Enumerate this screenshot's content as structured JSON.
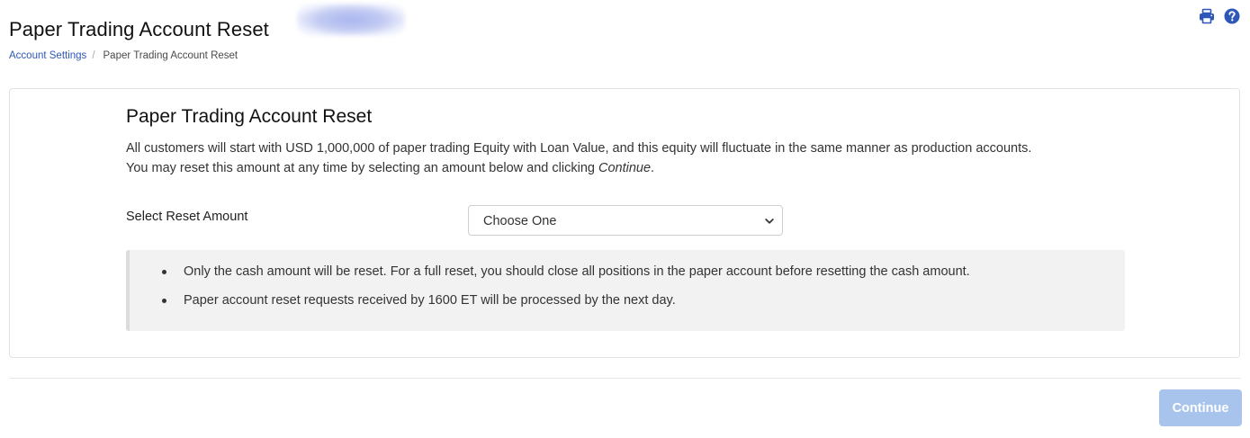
{
  "header": {
    "title": "Paper Trading Account Reset",
    "icons": [
      "printer-icon",
      "help-icon"
    ]
  },
  "breadcrumb": {
    "items": [
      {
        "label": "Account Settings",
        "link": true
      },
      {
        "label": "Paper Trading Account Reset",
        "link": false
      }
    ],
    "separator": "/"
  },
  "main": {
    "title": "Paper Trading Account Reset",
    "intro_line1": "All customers will start with USD 1,000,000 of paper trading Equity with Loan Value, and this equity will fluctuate in the same manner as production accounts.",
    "intro_line2_prefix": "You may reset this amount at any time by selecting an amount below and clicking ",
    "intro_line2_emphasis": "Continue",
    "intro_line2_suffix": ".",
    "reset_label": "Select Reset Amount",
    "reset_select": {
      "selected": "Choose One"
    },
    "notes": [
      "Only the cash amount will be reset. For a full reset, you should close all positions in the paper account before resetting the cash amount.",
      "Paper account reset requests received by 1600 ET will be processed by the next day."
    ]
  },
  "footer": {
    "continue_label": "Continue"
  },
  "colors": {
    "link": "#2e57b8",
    "icon": "#2e57b8",
    "continue_disabled_bg": "#a9c4ec",
    "notice_bg": "#f2f2f2",
    "notice_border": "#dcdcdc"
  }
}
